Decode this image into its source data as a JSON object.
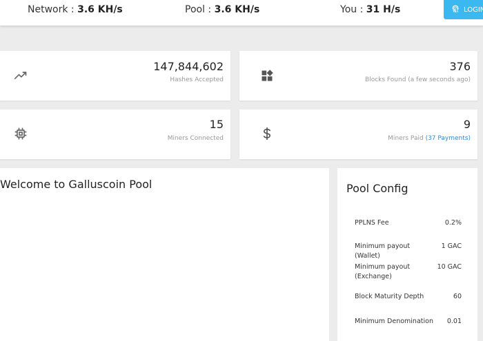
{
  "topbar": {
    "network_label": "Network :",
    "network_value": "3.6 KH/s",
    "pool_label": "Pool :",
    "pool_value": "3.6 KH/s",
    "you_label": "You :",
    "you_value": "31 H/s",
    "login_label": "LOGIN",
    "login_icon": "fingerprint-icon",
    "accent_color": "#3cb8f0"
  },
  "cards": {
    "hashes": {
      "value": "147,844,602",
      "label": "Hashes Accepted",
      "icon": "trend-icon"
    },
    "blocks": {
      "value": "376",
      "label": "Blocks Found",
      "sub": "(a few seconds ago)",
      "icon": "widgets-icon"
    },
    "miners": {
      "value": "15",
      "label": "Miners Connected",
      "icon": "chip-icon"
    },
    "paid": {
      "value": "9",
      "label": "Miners Paid",
      "link": "(37 Payments)",
      "icon": "dollar-icon",
      "link_color": "#3a86c8"
    }
  },
  "welcome": {
    "title": "Welcome to Galluscoin Pool"
  },
  "config": {
    "title": "Pool Config",
    "rows": [
      {
        "key": "PPLNS Fee",
        "value": "0.2%"
      },
      {
        "key": "Minimum payout (Wallet)",
        "value": "1 GAC"
      },
      {
        "key": "Minimum payout (Exchange)",
        "value": "10 GAC"
      },
      {
        "key": "Block Maturity Depth",
        "value": "60"
      },
      {
        "key": "Minimum Denomination",
        "value": "0.01"
      }
    ]
  }
}
